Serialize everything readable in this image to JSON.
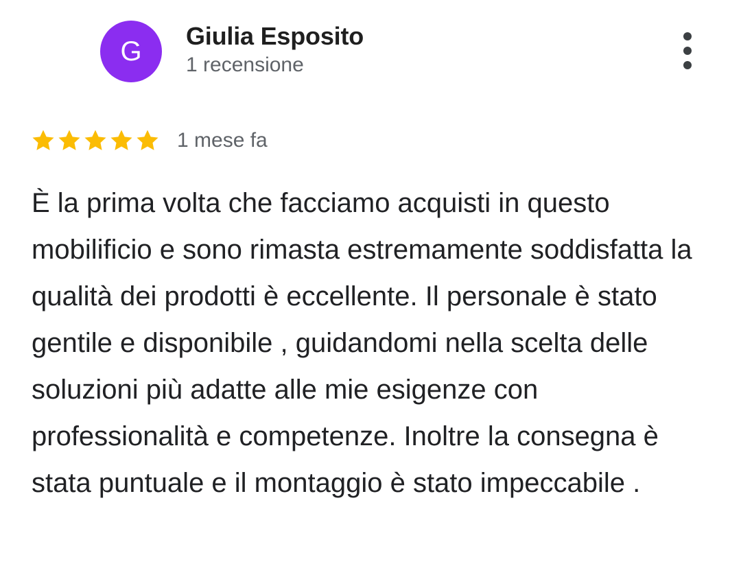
{
  "review": {
    "author": {
      "initial": "G",
      "name": "Giulia Esposito",
      "review_count_label": "1 recensione",
      "avatar_color": "#8b2df0"
    },
    "menu_icon": "more-vert-icon",
    "rating": {
      "stars": 5,
      "max_stars": 5,
      "star_color": "#fbbc04",
      "date_label": "1 mese fa"
    },
    "text": "È la prima volta che facciamo acquisti in questo mobilificio e sono rimasta estremamente soddisfatta la qualità dei prodotti è eccellente. Il personale è stato gentile e disponibile , guidandomi nella scelta delle soluzioni più adatte alle mie esigenze con professionalità e competenze. Inoltre la consegna è stata puntuale e il montaggio è stato impeccabile ."
  }
}
